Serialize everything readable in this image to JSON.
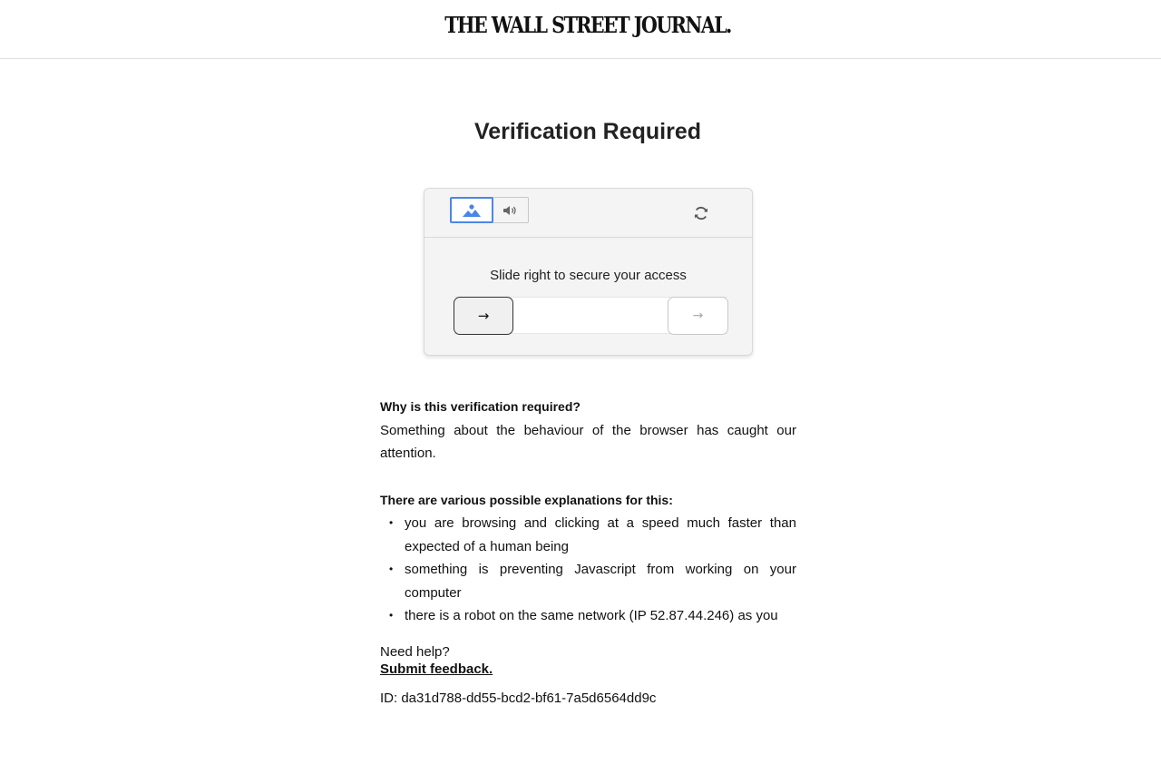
{
  "header": {
    "logo_text": "THE WALL STREET JOURNAL."
  },
  "page": {
    "title": "Verification Required"
  },
  "captcha": {
    "modes": [
      {
        "name": "image",
        "icon": "image-icon",
        "active": true
      },
      {
        "name": "audio",
        "icon": "speaker-icon",
        "active": false
      }
    ],
    "refresh_icon": "refresh-icon",
    "prompt": "Slide right to secure your access",
    "handle_icon": "→",
    "target_icon": "→",
    "accent_color": "#4a86e8"
  },
  "info": {
    "why_heading": "Why is this verification required?",
    "why_text": "Something about the behaviour of the browser has caught our attention.",
    "explanations_heading": "There are various possible explanations for this:",
    "explanations": [
      "you are browsing and clicking at a speed much faster than expected of a human being",
      "something is preventing Javascript from working on your computer",
      "there is a robot on the same network (IP 52.87.44.246) as you"
    ]
  },
  "help": {
    "label": "Need help?",
    "link_text": "Submit feedback."
  },
  "request_id": "ID: da31d788-dd55-bcd2-bf61-7a5d6564dd9c"
}
